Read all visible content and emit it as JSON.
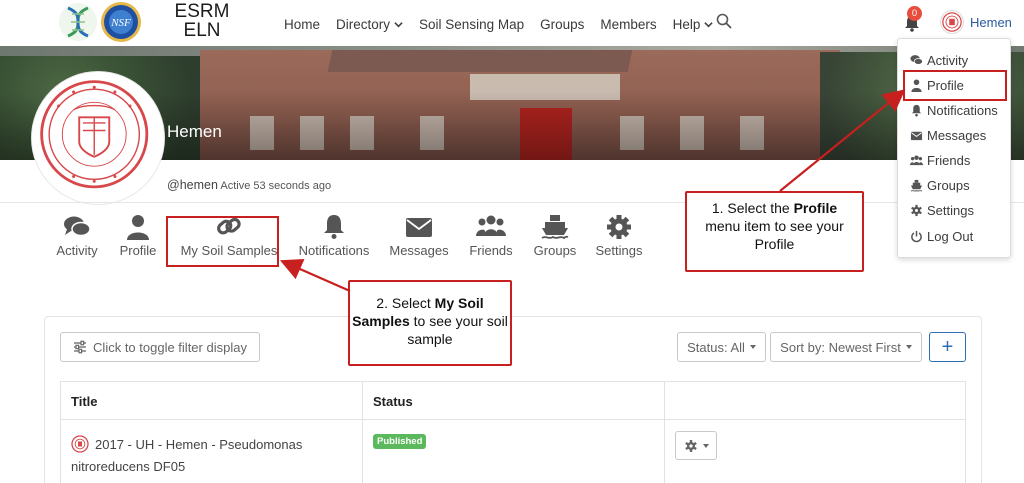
{
  "brand": {
    "line1": "ESRM",
    "line2": "ELN",
    "nsf_text": "NSF"
  },
  "nav": {
    "links": [
      {
        "label": "Home",
        "dropdown": false
      },
      {
        "label": "Directory",
        "dropdown": true
      },
      {
        "label": "Soil Sensing Map",
        "dropdown": false
      },
      {
        "label": "Groups",
        "dropdown": false
      },
      {
        "label": "Members",
        "dropdown": false
      },
      {
        "label": "Help",
        "dropdown": true
      }
    ],
    "notification_count": "0",
    "user_name": "Hemen"
  },
  "profile": {
    "name": "Hemen",
    "handle": "@hemen",
    "activity": "Active 53 seconds ago"
  },
  "tabs": [
    {
      "label": "Activity",
      "icon": "comments-icon"
    },
    {
      "label": "Profile",
      "icon": "user-icon"
    },
    {
      "label": "My Soil Samples",
      "icon": "link-icon"
    },
    {
      "label": "Notifications",
      "icon": "bell-icon"
    },
    {
      "label": "Messages",
      "icon": "envelope-icon"
    },
    {
      "label": "Friends",
      "icon": "users-icon"
    },
    {
      "label": "Groups",
      "icon": "ship-icon"
    },
    {
      "label": "Settings",
      "icon": "gear-icon"
    }
  ],
  "dropdown": {
    "items": [
      {
        "label": "Activity",
        "icon": "comments-icon"
      },
      {
        "label": "Profile",
        "icon": "user-icon"
      },
      {
        "label": "Notifications",
        "icon": "bell-icon"
      },
      {
        "label": "Messages",
        "icon": "envelope-icon"
      },
      {
        "label": "Friends",
        "icon": "users-icon"
      },
      {
        "label": "Groups",
        "icon": "ship-icon"
      },
      {
        "label": "Settings",
        "icon": "gear-icon"
      },
      {
        "label": "Log Out",
        "icon": "power-icon"
      }
    ]
  },
  "callouts": {
    "one": {
      "prefix": "1. Select the ",
      "bold": "Profile",
      "suffix": " menu item to see your Profile"
    },
    "two": {
      "prefix": "2. Select ",
      "bold": "My Soil Samples",
      "suffix": " to see your soil sample"
    }
  },
  "filters": {
    "toggle_label": "Click to toggle filter display",
    "status_label": "Status: All",
    "sort_label": "Sort by: Newest First",
    "add_label": "+"
  },
  "table": {
    "headers": [
      "Title",
      "Status",
      ""
    ],
    "rows": [
      {
        "title": "2017 - UH - Hemen - Pseudomonas nitroreducens DF05",
        "status": "Published"
      }
    ]
  },
  "colors": {
    "accent": "#c81f1f",
    "link": "#2a5aa0",
    "published": "#5cb85c",
    "badge": "#e74c3c"
  }
}
